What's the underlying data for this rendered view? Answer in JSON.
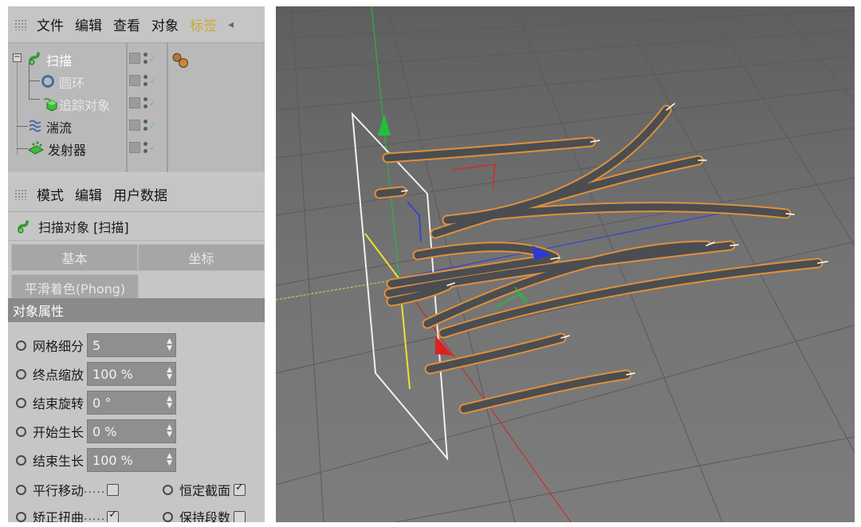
{
  "object_manager": {
    "menu": [
      {
        "label": "文件",
        "highlight": false
      },
      {
        "label": "编辑",
        "highlight": false
      },
      {
        "label": "查看",
        "highlight": false
      },
      {
        "label": "对象",
        "highlight": false
      },
      {
        "label": "标签",
        "highlight": true
      }
    ],
    "tree": [
      {
        "name": "扫描",
        "icon": "sweep-icon",
        "state": "active"
      },
      {
        "name": "圆环",
        "icon": "circle-spline-icon",
        "state": "disabled"
      },
      {
        "name": "追踪对象",
        "icon": "tracer-icon",
        "state": "disabled"
      },
      {
        "name": "湍流",
        "icon": "turbulence-icon",
        "state": "normal"
      },
      {
        "name": "发射器",
        "icon": "emitter-icon",
        "state": "normal"
      }
    ]
  },
  "attribute_manager": {
    "menu": [
      {
        "label": "模式"
      },
      {
        "label": "编辑"
      },
      {
        "label": "用户数据"
      }
    ],
    "object_title": "扫描对象 [扫描]",
    "tabs": [
      "基本",
      "坐标"
    ],
    "sub_tab": "平滑着色(Phong)",
    "section": "对象属性",
    "params": [
      {
        "label": "网格细分",
        "value": "5"
      },
      {
        "label": "终点缩放",
        "value": "100 %"
      },
      {
        "label": "结束旋转",
        "value": "0 °"
      },
      {
        "label": "开始生长",
        "value": "0 %"
      },
      {
        "label": "结束生长",
        "value": "100 %"
      }
    ],
    "checks": [
      [
        {
          "label": "平行移动",
          "checked": false
        },
        {
          "label": "恒定截面",
          "checked": true
        }
      ],
      [
        {
          "label": "矫正扭曲",
          "checked": true
        },
        {
          "label": "保持段数",
          "checked": false
        }
      ]
    ]
  },
  "viewport": {
    "colors": {
      "tube": "#4a4d52",
      "tube_outline": "#e0903a",
      "axis_y": "#22c03a",
      "axis_x": "#e02020",
      "axis_z": "#2a3ad8"
    }
  }
}
